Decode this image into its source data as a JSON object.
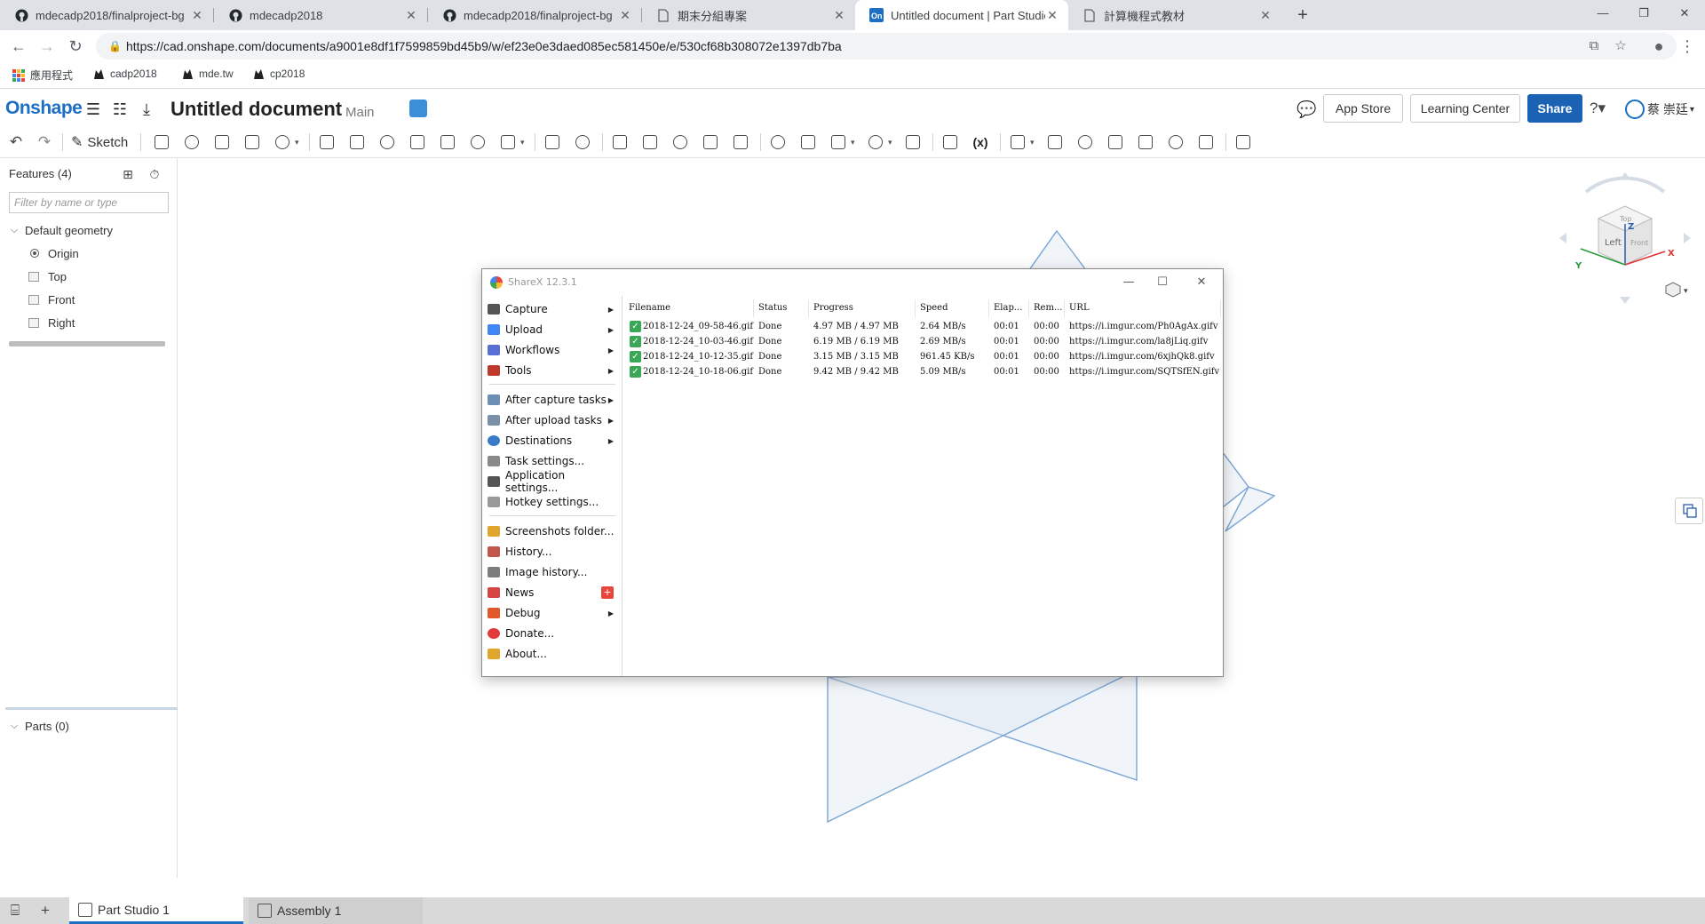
{
  "browser": {
    "tabs": [
      {
        "title": "mdecadp2018/finalproject-bg",
        "icon": "github-icon"
      },
      {
        "title": "mdecadp2018",
        "icon": "github-icon"
      },
      {
        "title": "mdecadp2018/finalproject-bg",
        "icon": "github-icon"
      },
      {
        "title": "期末分組專案",
        "icon": "document-icon"
      },
      {
        "title": "Untitled document | Part Studio",
        "icon": "onshape-icon",
        "active": true
      },
      {
        "title": "計算機程式教材",
        "icon": "document-icon"
      }
    ],
    "url": "https://cad.onshape.com/documents/a9001e8df1f7599859bd45b9/w/ef23e0e3daed085ec581450e/e/530cf68b308072e1397db7ba",
    "bookmarks": [
      {
        "label": "應用程式",
        "icon": "apps-grid-icon"
      },
      {
        "label": "cadp2018",
        "icon": "bookmark-cat-icon"
      },
      {
        "label": "mde.tw",
        "icon": "bookmark-cat-icon"
      },
      {
        "label": "cp2018",
        "icon": "bookmark-cat-icon"
      }
    ]
  },
  "onshape": {
    "logo": "Onshape",
    "document_title": "Untitled document",
    "branch": "Main",
    "header_buttons": {
      "app_store": "App Store",
      "learning_center": "Learning Center",
      "share": "Share"
    },
    "user_name": "蔡 崇廷",
    "toolbar": {
      "sketch_label": "Sketch"
    },
    "features": {
      "title": "Features (4)",
      "filter_placeholder": "Filter by name or type",
      "group": "Default geometry",
      "items": [
        "Origin",
        "Top",
        "Front",
        "Right"
      ],
      "parts": "Parts (0)"
    },
    "viewcube": {
      "faces": [
        "Top",
        "Left",
        "Front"
      ],
      "axes": [
        "Z",
        "X",
        "Y"
      ]
    },
    "bottom_tabs": [
      "Part Studio 1",
      "Assembly 1"
    ],
    "colors": {
      "brand": "#1d6fc4",
      "share_button": "#1b62b5",
      "plane_stroke": "#6f9fd1"
    }
  },
  "sharex": {
    "title": "ShareX 12.3.1",
    "menu": [
      {
        "label": "Capture",
        "submenu": true,
        "icon": "camera-icon"
      },
      {
        "label": "Upload",
        "submenu": true,
        "icon": "upload-arrow-icon"
      },
      {
        "label": "Workflows",
        "submenu": true,
        "icon": "workflows-grid-icon"
      },
      {
        "label": "Tools",
        "submenu": true,
        "icon": "toolbox-icon"
      },
      {
        "label": "After capture tasks",
        "submenu": true,
        "icon": "after-capture-icon"
      },
      {
        "label": "After upload tasks",
        "submenu": true,
        "icon": "after-upload-icon"
      },
      {
        "label": "Destinations",
        "submenu": true,
        "icon": "globe-icon"
      },
      {
        "label": "Task settings...",
        "submenu": false,
        "icon": "gear-icon"
      },
      {
        "label": "Application settings...",
        "submenu": false,
        "icon": "wrench-icon"
      },
      {
        "label": "Hotkey settings...",
        "submenu": false,
        "icon": "keyboard-icon"
      },
      {
        "label": "Screenshots folder...",
        "submenu": false,
        "icon": "folder-icon"
      },
      {
        "label": "History...",
        "submenu": false,
        "icon": "history-icon"
      },
      {
        "label": "Image history...",
        "submenu": false,
        "icon": "image-history-icon"
      },
      {
        "label": "News",
        "submenu": false,
        "icon": "megaphone-icon",
        "badge": "+"
      },
      {
        "label": "Debug",
        "submenu": true,
        "icon": "traffic-cone-icon"
      },
      {
        "label": "Donate...",
        "submenu": false,
        "icon": "heart-icon"
      },
      {
        "label": "About...",
        "submenu": false,
        "icon": "crown-icon"
      }
    ],
    "columns": [
      "Filename",
      "Status",
      "Progress",
      "Speed",
      "Elap...",
      "Rem...",
      "URL"
    ],
    "rows": [
      [
        "2018-12-24_09-58-46.gif",
        "Done",
        "4.97 MB / 4.97 MB",
        "2.64 MB/s",
        "00:01",
        "00:00",
        "https://i.imgur.com/Ph0AgAx.gifv"
      ],
      [
        "2018-12-24_10-03-46.gif",
        "Done",
        "6.19 MB / 6.19 MB",
        "2.69 MB/s",
        "00:01",
        "00:00",
        "https://i.imgur.com/la8jLiq.gifv"
      ],
      [
        "2018-12-24_10-12-35.gif",
        "Done",
        "3.15 MB / 3.15 MB",
        "961.45 KB/s",
        "00:01",
        "00:00",
        "https://i.imgur.com/6xjhQk8.gifv"
      ],
      [
        "2018-12-24_10-18-06.gif",
        "Done",
        "9.42 MB / 9.42 MB",
        "5.09 MB/s",
        "00:01",
        "00:00",
        "https://i.imgur.com/SQTSfEN.gifv"
      ]
    ]
  }
}
